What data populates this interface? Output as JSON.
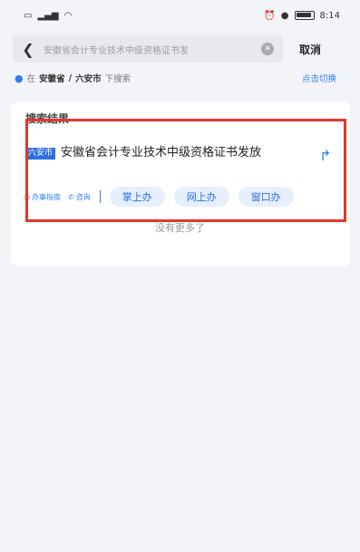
{
  "status_bar": {
    "left_icons": [
      "sim-icon",
      "signal-icon",
      "wifi-icon"
    ],
    "right_icons": [
      "alarm-icon",
      "location-icon",
      "battery-icon"
    ],
    "time": "8:14"
  },
  "search": {
    "query": "安徽省会计专业技术中级资格证书发",
    "cancel_label": "取消"
  },
  "location": {
    "prefix": "在",
    "province": "安徽省",
    "separator": "/",
    "city": "六安市",
    "suffix": "下搜索",
    "switch_label": "点击切换"
  },
  "results": {
    "section_title": "搜索结果",
    "items": [
      {
        "region_tag": "六安市",
        "title": "安徽省会计专业技术中级资格证书发放",
        "guide_label": "办事指南",
        "consult_label": "咨询",
        "channels": [
          "掌上办",
          "网上办",
          "窗口办"
        ]
      }
    ],
    "no_more_text": "没有更多了"
  },
  "colors": {
    "accent": "#2e7ef0",
    "highlight": "#e0392b",
    "background": "#f3f4f8"
  }
}
